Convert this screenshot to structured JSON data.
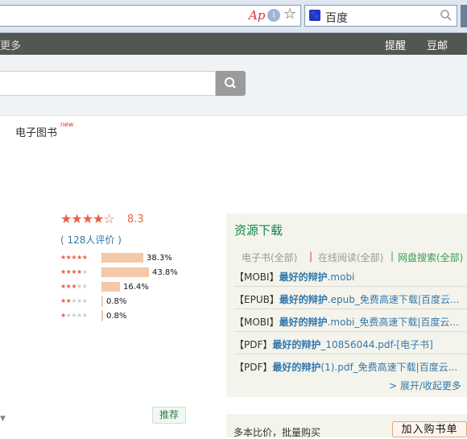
{
  "browser": {
    "search_engine_label": "百度",
    "reader_icon": "Ap",
    "search_engine_icon": "baidu-paw-icon"
  },
  "nav": {
    "more": "更多",
    "remind": "提醒",
    "mail": "豆邮"
  },
  "header": {
    "tab_ebook": "电子图书",
    "new_badge": "new"
  },
  "rating": {
    "stars_text": "★★★★☆",
    "score": "8.3",
    "count": "( 128人评价 )",
    "rows": [
      {
        "stars": 5,
        "percent": 38.3,
        "label": "38.3%"
      },
      {
        "stars": 4,
        "percent": 43.8,
        "label": "43.8%"
      },
      {
        "stars": 3,
        "percent": 16.4,
        "label": "16.4%"
      },
      {
        "stars": 2,
        "percent": 0.8,
        "label": "0.8%"
      },
      {
        "stars": 1,
        "percent": 0.8,
        "label": "0.8%"
      }
    ]
  },
  "recommend_label": "推荐",
  "resources": {
    "title": "资源下载",
    "filter_ebook": "电子书(全部)",
    "sep": "|",
    "filter_online": "在线阅读(全部)",
    "filter_netdisk": "网盘搜索(全部)",
    "items": [
      {
        "tag": "【MOBI】",
        "title": "最好的辩护",
        "rest": ".mobi"
      },
      {
        "tag": "【EPUB】",
        "title": "最好的辩护",
        "rest": ".epub_免费高速下载|百度云..."
      },
      {
        "tag": "【MOBI】",
        "title": "最好的辩护",
        "rest": ".mobi_免费高速下载|百度云..."
      },
      {
        "tag": "【PDF】",
        "title": "最好的辩护",
        "rest": "_10856044.pdf-[电子书]"
      },
      {
        "tag": "【PDF】",
        "title": "最好的辩护",
        "rest": "(1).pdf_免费高速下载|百度云..."
      }
    ],
    "expand": "> 展开/收起更多"
  },
  "compare": {
    "label": "多本比价，批量购买",
    "add_cart": "加入购书单"
  }
}
